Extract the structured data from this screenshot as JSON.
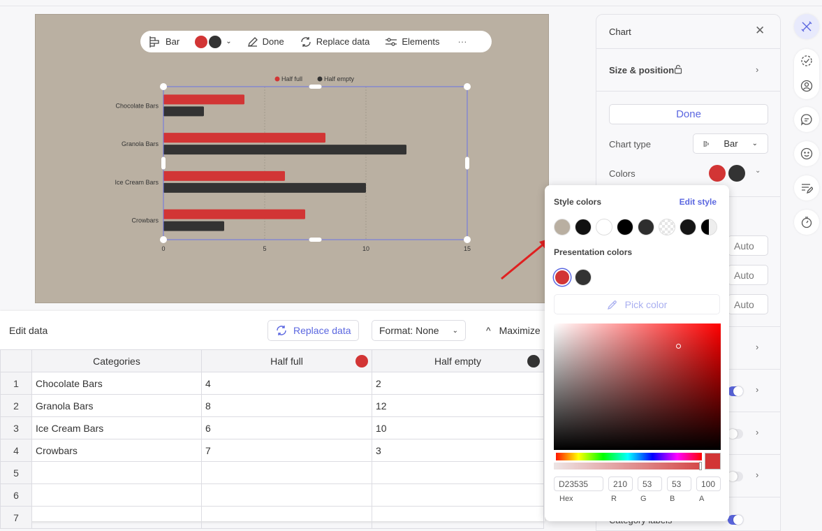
{
  "colors": {
    "slide_bg": "#bab0a2",
    "series1": "#d23535",
    "series2": "#333333",
    "accent": "#5b67e0",
    "arrow": "#e02020"
  },
  "toolbar": {
    "chart_type": "Bar",
    "done": "Done",
    "replace_data": "Replace data",
    "elements": "Elements",
    "more": "···"
  },
  "chart_data": {
    "type": "bar",
    "orientation": "horizontal",
    "categories": [
      "Chocolate Bars",
      "Granola Bars",
      "Ice Cream Bars",
      "Crowbars"
    ],
    "series": [
      {
        "name": "Half full",
        "values": [
          4,
          8,
          6,
          7
        ],
        "color": "#d23535"
      },
      {
        "name": "Half empty",
        "values": [
          2,
          12,
          10,
          3
        ],
        "color": "#333333"
      }
    ],
    "xlim": [
      0,
      15
    ],
    "xticks": [
      "0",
      "5",
      "10",
      "15"
    ],
    "grid": true,
    "legend": "top"
  },
  "edit_data": {
    "title": "Edit data",
    "replace_data": "Replace data",
    "format": "Format: None",
    "maximize": "Maximize",
    "headers": [
      "Categories",
      "Half full",
      "Half empty"
    ],
    "rows": [
      [
        "1",
        "Chocolate Bars",
        "4",
        "2"
      ],
      [
        "2",
        "Granola Bars",
        "8",
        "12"
      ],
      [
        "3",
        "Ice Cream Bars",
        "6",
        "10"
      ],
      [
        "4",
        "Crowbars",
        "7",
        "3"
      ],
      [
        "5",
        "",
        "",
        ""
      ],
      [
        "6",
        "",
        "",
        ""
      ],
      [
        "7",
        "",
        "",
        ""
      ]
    ]
  },
  "panel": {
    "title": "Chart",
    "size_position": "Size & position",
    "done": "Done",
    "chart_type_label": "Chart type",
    "chart_type_value": "Bar",
    "colors_label": "Colors",
    "auto": [
      "Auto",
      "Auto",
      "Auto"
    ],
    "category_labels": "Category labels"
  },
  "popup": {
    "style_colors": "Style colors",
    "edit_style": "Edit style",
    "style_swatches": [
      "#b9afa1",
      "#111111",
      "#ffffff",
      "#000000",
      "#2e2e2e",
      "transparent",
      "#151515",
      "half"
    ],
    "presentation_colors": "Presentation colors",
    "presentation_swatches": [
      "#d23535",
      "#333333"
    ],
    "pick_color": "Pick color",
    "hex": "D23535",
    "r": "210",
    "g": "53",
    "b": "53",
    "a": "100",
    "labels": [
      "Hex",
      "R",
      "G",
      "B",
      "A"
    ]
  }
}
